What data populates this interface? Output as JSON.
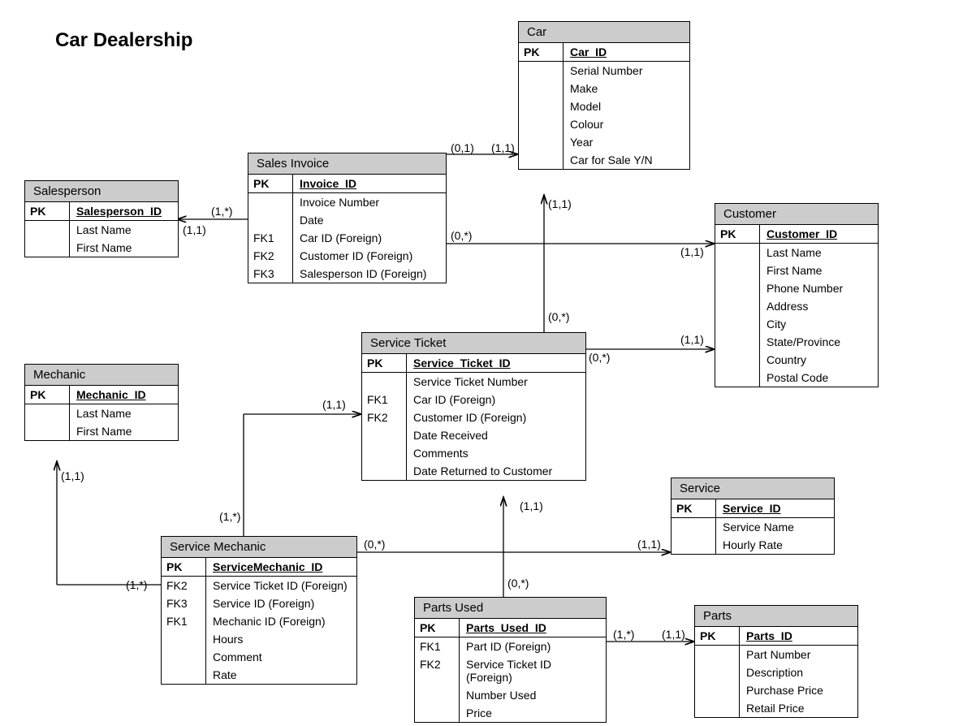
{
  "title": "Car Dealership",
  "entities": {
    "salesperson": {
      "header": "Salesperson",
      "pk_label": "PK",
      "pk_field": "Salesperson_ID",
      "attrs": [
        "Last Name",
        "First Name"
      ]
    },
    "mechanic": {
      "header": "Mechanic",
      "pk_label": "PK",
      "pk_field": "Mechanic_ID",
      "attrs": [
        "Last Name",
        "First Name"
      ]
    },
    "sales_invoice": {
      "header": "Sales Invoice",
      "pk_label": "PK",
      "pk_field": "Invoice_ID",
      "fk_rows": [
        {
          "key": "",
          "val": "Invoice Number"
        },
        {
          "key": "",
          "val": "Date"
        },
        {
          "key": "FK1",
          "val": "Car ID (Foreign)"
        },
        {
          "key": "FK2",
          "val": "Customer ID (Foreign)"
        },
        {
          "key": "FK3",
          "val": "Salesperson ID (Foreign)"
        }
      ]
    },
    "car": {
      "header": "Car",
      "pk_label": "PK",
      "pk_field": "Car_ID",
      "attrs": [
        "Serial Number",
        "Make",
        "Model",
        "Colour",
        "Year",
        "Car for Sale Y/N"
      ]
    },
    "customer": {
      "header": "Customer",
      "pk_label": "PK",
      "pk_field": "Customer_ID",
      "attrs": [
        "Last Name",
        "First Name",
        "Phone Number",
        "Address",
        "City",
        "State/Province",
        "Country",
        "Postal Code"
      ]
    },
    "service_ticket": {
      "header": "Service Ticket",
      "pk_label": "PK",
      "pk_field": "Service_Ticket_ID",
      "fk_rows": [
        {
          "key": "",
          "val": "Service Ticket Number"
        },
        {
          "key": "FK1",
          "val": "Car ID (Foreign)"
        },
        {
          "key": "FK2",
          "val": "Customer ID (Foreign)"
        },
        {
          "key": "",
          "val": "Date Received"
        },
        {
          "key": "",
          "val": "Comments"
        },
        {
          "key": "",
          "val": "Date Returned to Customer"
        }
      ]
    },
    "service_mechanic": {
      "header": "Service Mechanic",
      "pk_label": "PK",
      "pk_field": "ServiceMechanic_ID",
      "fk_rows": [
        {
          "key": "FK2",
          "val": "Service Ticket ID (Foreign)"
        },
        {
          "key": "FK3",
          "val": "Service ID (Foreign)"
        },
        {
          "key": "FK1",
          "val": "Mechanic ID (Foreign)"
        },
        {
          "key": "",
          "val": "Hours"
        },
        {
          "key": "",
          "val": "Comment"
        },
        {
          "key": "",
          "val": "Rate"
        }
      ]
    },
    "parts_used": {
      "header": "Parts Used",
      "pk_label": "PK",
      "pk_field": "Parts_Used_ID",
      "fk_rows": [
        {
          "key": "FK1",
          "val": "Part ID (Foreign)"
        },
        {
          "key": "FK2",
          "val": "Service Ticket ID (Foreign)"
        },
        {
          "key": "",
          "val": "Number Used"
        },
        {
          "key": "",
          "val": "Price"
        }
      ]
    },
    "service": {
      "header": "Service",
      "pk_label": "PK",
      "pk_field": "Service_ID",
      "attrs": [
        "Service Name",
        "Hourly Rate"
      ]
    },
    "parts": {
      "header": "Parts",
      "pk_label": "PK",
      "pk_field": "Parts_ID",
      "attrs": [
        "Part Number",
        "Description",
        "Purchase Price",
        "Retail Price"
      ]
    }
  },
  "labels": {
    "l01": "(0,1)",
    "l11a": "(1,1)",
    "l1s_a": "(1,*)",
    "l11_b": "(1,1)",
    "l0s_a": "(0,*)",
    "l11_c": "(1,1)",
    "l11_d": "(1,1)",
    "l0s_b": "(0,*)",
    "l0s_c": "(0,*)",
    "l11_e": "(1,1)",
    "l11_f": "(1,1)",
    "l1s_b": "(1,*)",
    "l0s_d": "(0,*)",
    "l11_g": "(1,1)",
    "l11_h": "(1,1)",
    "l0s_e": "(0,*)",
    "l1s_c": "(1,*)",
    "l11_i": "(1,1)",
    "l1s_d": "(1,*)",
    "l11_j": "(1,1)"
  }
}
